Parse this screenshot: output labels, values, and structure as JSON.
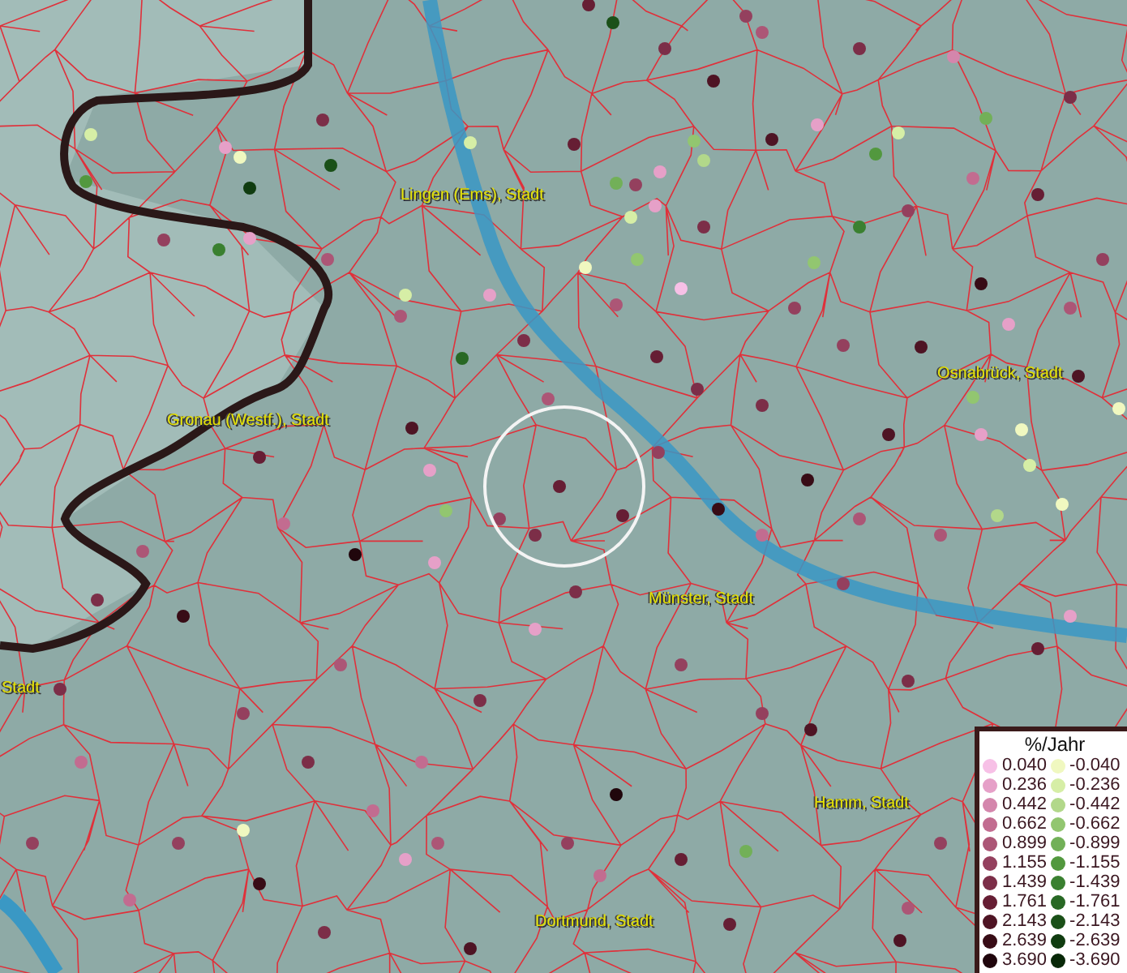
{
  "map": {
    "place_labels": [
      {
        "text": "Lingen (Ems), Stadt"
      },
      {
        "text": "Gronau (Westf.), Stadt"
      },
      {
        "text": "Osnabrück, Stadt"
      },
      {
        "text": "Münster, Stadt"
      },
      {
        "text": "Stadt"
      },
      {
        "text": "Hamm, Stadt"
      },
      {
        "text": "Dortmund, Stadt"
      }
    ]
  },
  "legend": {
    "title": "%/Jahr",
    "columns": [
      {
        "entries": [
          {
            "label": "0.040",
            "color": "#f7c0e6"
          },
          {
            "label": "0.236",
            "color": "#e6a0c8"
          },
          {
            "label": "0.442",
            "color": "#d486ac"
          },
          {
            "label": "0.662",
            "color": "#c26c90"
          },
          {
            "label": "0.899",
            "color": "#ac5676"
          },
          {
            "label": "1.155",
            "color": "#94405e"
          },
          {
            "label": "1.439",
            "color": "#7c2e48"
          },
          {
            "label": "1.761",
            "color": "#661e34"
          },
          {
            "label": "2.143",
            "color": "#4e1424"
          },
          {
            "label": "2.639",
            "color": "#380c16"
          },
          {
            "label": "3.690",
            "color": "#20060c"
          }
        ]
      },
      {
        "entries": [
          {
            "label": "-0.040",
            "color": "#f0f8c0"
          },
          {
            "label": "-0.236",
            "color": "#d6eea6"
          },
          {
            "label": "-0.442",
            "color": "#b2d88a"
          },
          {
            "label": "-0.662",
            "color": "#92c670"
          },
          {
            "label": "-0.899",
            "color": "#72b058"
          },
          {
            "label": "-1.155",
            "color": "#52983e"
          },
          {
            "label": "-1.439",
            "color": "#3a8030"
          },
          {
            "label": "-1.761",
            "color": "#286824"
          },
          {
            "label": "-2.143",
            "color": "#1a5018"
          },
          {
            "label": "-2.639",
            "color": "#103c10"
          },
          {
            "label": "-3.690",
            "color": "#082808"
          }
        ]
      }
    ]
  }
}
